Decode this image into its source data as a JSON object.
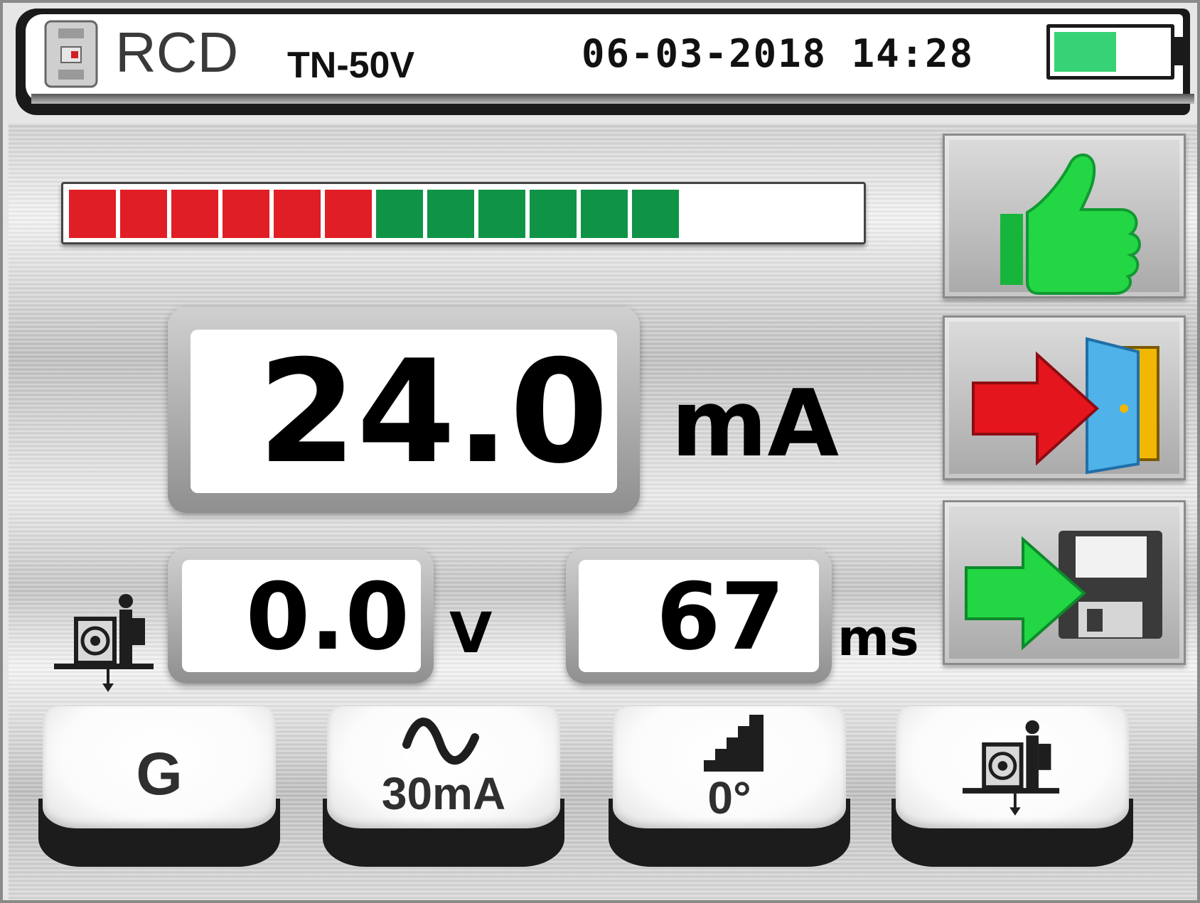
{
  "header": {
    "title": "RCD",
    "mode": "TN-50V",
    "datetime": "06-03-2018 14:28",
    "battery_level": 0.55,
    "battery_color": "#38d276",
    "icon": "rcd-breaker-icon"
  },
  "bar_graph": {
    "segments_red": 6,
    "segments_green": 6,
    "segments_total": 16,
    "red_color": "#e01e26",
    "green_color": "#0f9447"
  },
  "readings": {
    "main": {
      "value": "24.0",
      "unit": "mA"
    },
    "voltage": {
      "value": "0.0",
      "unit": "V"
    },
    "time": {
      "value": "67",
      "unit": "ms"
    }
  },
  "status_icons": {
    "contact_voltage_icon": "earth-electrode-icon"
  },
  "side_buttons": [
    {
      "name": "result-ok",
      "icon": "thumbs-up-icon"
    },
    {
      "name": "exit",
      "icon": "exit-door-icon"
    },
    {
      "name": "save",
      "icon": "save-floppy-icon"
    }
  ],
  "soft_keys": [
    {
      "label": "G"
    },
    {
      "label": "30mA",
      "icon": "ac-sine-icon"
    },
    {
      "label": "0°",
      "icon": "ramp-steps-icon"
    },
    {
      "label": "",
      "icon": "earth-electrode-icon"
    }
  ]
}
